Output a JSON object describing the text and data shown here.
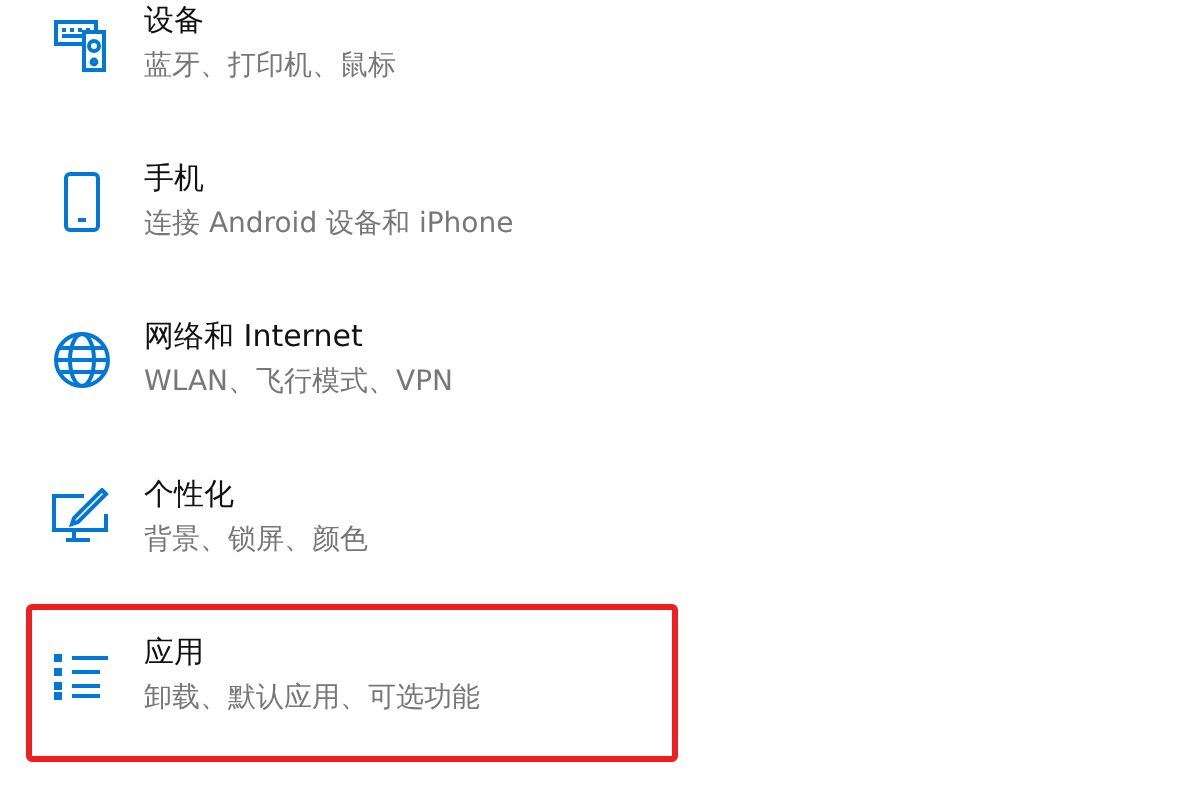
{
  "settings_items": [
    {
      "kind": "devices",
      "title": "设备",
      "subtitle": "蓝牙、打印机、鼠标",
      "highlighted": false
    },
    {
      "kind": "phone",
      "title": "手机",
      "subtitle": "连接 Android 设备和 iPhone",
      "highlighted": false
    },
    {
      "kind": "network",
      "title": "网络和 Internet",
      "subtitle": "WLAN、飞行模式、VPN",
      "highlighted": false
    },
    {
      "kind": "personalization",
      "title": "个性化",
      "subtitle": "背景、锁屏、颜色",
      "highlighted": false
    },
    {
      "kind": "apps",
      "title": "应用",
      "subtitle": "卸载、默认应用、可选功能",
      "highlighted": true
    }
  ]
}
